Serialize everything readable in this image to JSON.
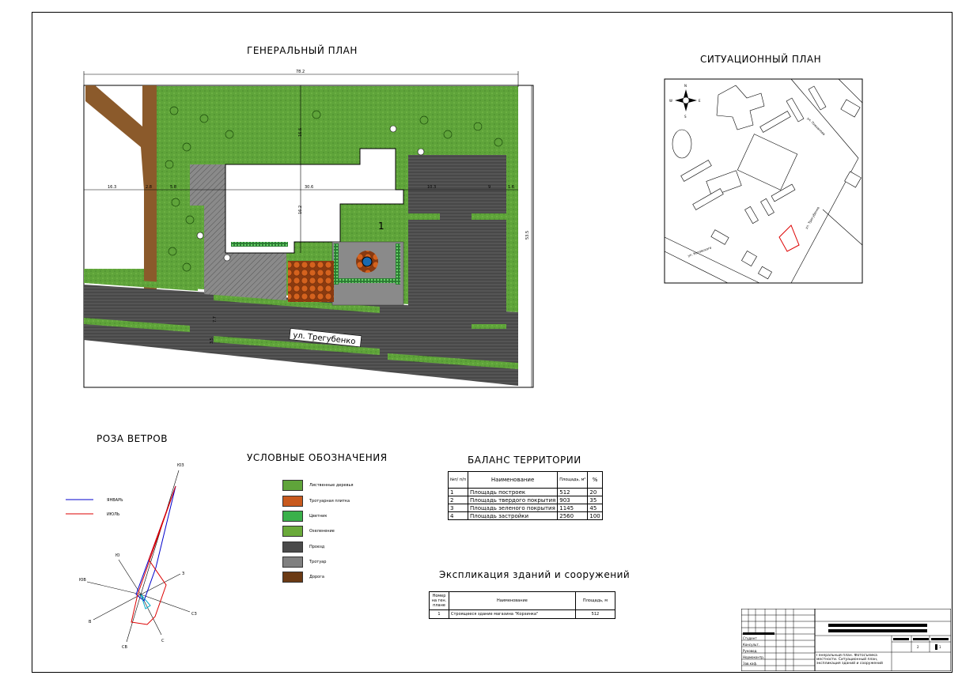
{
  "titles": {
    "general_plan": "ГЕНЕРАЛЬНЫЙ ПЛАН",
    "situation_plan": "СИТУАЦИОННЫЙ ПЛАН",
    "wind_rose": "РОЗА ВЕТРОВ",
    "legend": "УСЛОВНЫЕ ОБОЗНАЧЕНИЯ",
    "balance": "БАЛАНС ТЕРРИТОРИИ",
    "explication": "Экспликация зданий и сооружений"
  },
  "plan": {
    "street_label": "ул. Трегубенко",
    "building_number": "1",
    "dims": {
      "total_width": "78.2",
      "total_height": "53.5",
      "top_offset": "16.6",
      "left_seg1": "16.3",
      "left_seg2": "2.8",
      "left_seg3": "5.8",
      "mid_seg": "30.6",
      "right_seg1": "10.3",
      "right_seg2": "9",
      "right_seg3": "1.6",
      "building_depth": "16.2",
      "road_w1": "7.7",
      "road_w2": "3.5"
    }
  },
  "situation": {
    "compass_n": "N",
    "compass_s": "S",
    "compass_e": "E",
    "compass_w": "W",
    "street1": "ул. Плеханова",
    "street2": "ул. Трегубенко",
    "street3": "ул. Котовского"
  },
  "wind_rose": {
    "legend": [
      {
        "label": "ЯНВАРЬ",
        "color": "#0000cc"
      },
      {
        "label": "ИЮЛЬ",
        "color": "#dd0000"
      }
    ],
    "directions": {
      "nw_top": "ЮЗ",
      "n": "Ю",
      "w": "З",
      "nw": "ЮВ",
      "e": "СЗ",
      "sw": "В",
      "s": "С",
      "se": "СВ"
    }
  },
  "legend_items": [
    {
      "label": "Лиственные деревья",
      "color": "#5a9e32"
    },
    {
      "label": "Тротуарная плитка",
      "color": "#c85a1e"
    },
    {
      "label": "Цветник",
      "color": "#3ab04a"
    },
    {
      "label": "Озеленение",
      "color": "#6aaa3a"
    },
    {
      "label": "Проезд",
      "color": "#4a4a4a"
    },
    {
      "label": "Тротуар",
      "color": "#808080"
    },
    {
      "label": "Дорога",
      "color": "#6b3a14"
    }
  ],
  "balance": {
    "headers": [
      "№п/ п/п",
      "Наименование",
      "Площадь, м²",
      "%"
    ],
    "rows": [
      [
        "1",
        "Площадь построек",
        "512",
        "20"
      ],
      [
        "2",
        "Площадь твердого покрытия",
        "903",
        "35"
      ],
      [
        "3",
        "Площадь зеленого покрытия",
        "1145",
        "45"
      ],
      [
        "4",
        "Площадь застройки",
        "2560",
        "100"
      ]
    ]
  },
  "explication": {
    "headers": [
      "Номер на ген. плане",
      "Наименование",
      "Площадь, м"
    ],
    "rows": [
      [
        "1",
        "Строящееся здание магазина \"Корзинка\"",
        "512"
      ]
    ]
  },
  "stamp": {
    "roles": [
      "Студент",
      "Консульт.",
      "Руковод.",
      "Нормоконтр.",
      "Зав.каф."
    ],
    "sheet_no": "2",
    "sheets": "1",
    "desc": "Генеральный план. Фотосъемка местности. Ситуационный план, экспликация зданий и сооружений"
  }
}
